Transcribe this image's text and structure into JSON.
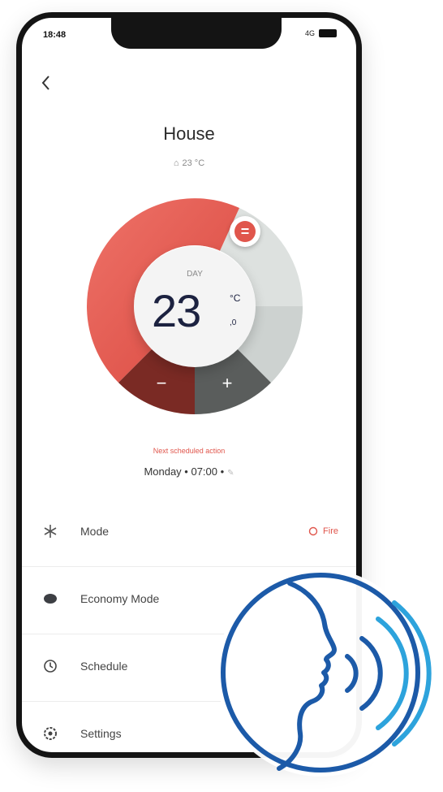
{
  "status": {
    "time": "18:48",
    "network": "4G"
  },
  "header": {
    "title": "House",
    "indoor_temp": "23 °C"
  },
  "dial": {
    "mode": "DAY",
    "temperature": "23",
    "unit": "°C",
    "decimal": ",0",
    "eq_symbol": "=",
    "minus_symbol": "−",
    "plus_symbol": "+"
  },
  "schedule_info": {
    "next_label": "Next scheduled action",
    "next_time": "Monday • 07:00 •"
  },
  "menu": {
    "items": [
      {
        "label": "Mode",
        "value": "Fire"
      },
      {
        "label": "Economy Mode"
      },
      {
        "label": "Schedule"
      },
      {
        "label": "Settings"
      }
    ]
  },
  "colors": {
    "accent_red": "#e0564c",
    "dark_red": "#7a2a24",
    "gray_ring": "#dcdfde",
    "dark_gray": "#5a5d5c"
  },
  "icons": {
    "back": "chevron-left-icon",
    "home": "home-icon",
    "mode": "snowflake-icon",
    "economy": "leaf-icon",
    "schedule": "clock-icon",
    "settings": "gear-icon",
    "voice": "voice-speaking-head-icon"
  }
}
